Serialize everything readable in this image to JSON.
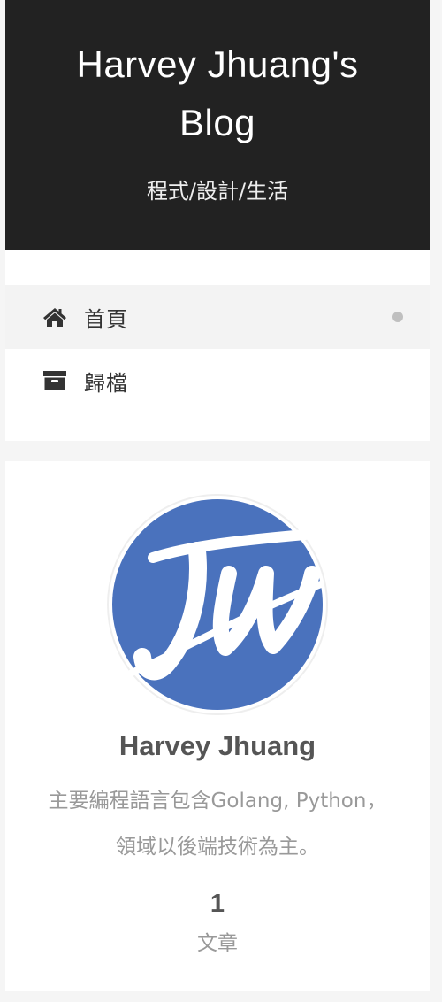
{
  "header": {
    "title_line1": "Harvey Jhuang's",
    "title_line2": "Blog",
    "subtitle": "程式/設計/生活"
  },
  "menu": {
    "items": [
      {
        "label": "首頁",
        "icon": "home-icon",
        "active": true
      },
      {
        "label": "歸檔",
        "icon": "archive-icon",
        "active": false
      }
    ]
  },
  "profile": {
    "avatar": "jw-logo",
    "avatar_color": "#4a72bd",
    "name": "Harvey Jhuang",
    "description_line1": "主要編程語言包含Golang, Python，",
    "description_line2": "領域以後端技術為主。",
    "stats": {
      "posts_count": "1",
      "posts_label": "文章"
    }
  }
}
